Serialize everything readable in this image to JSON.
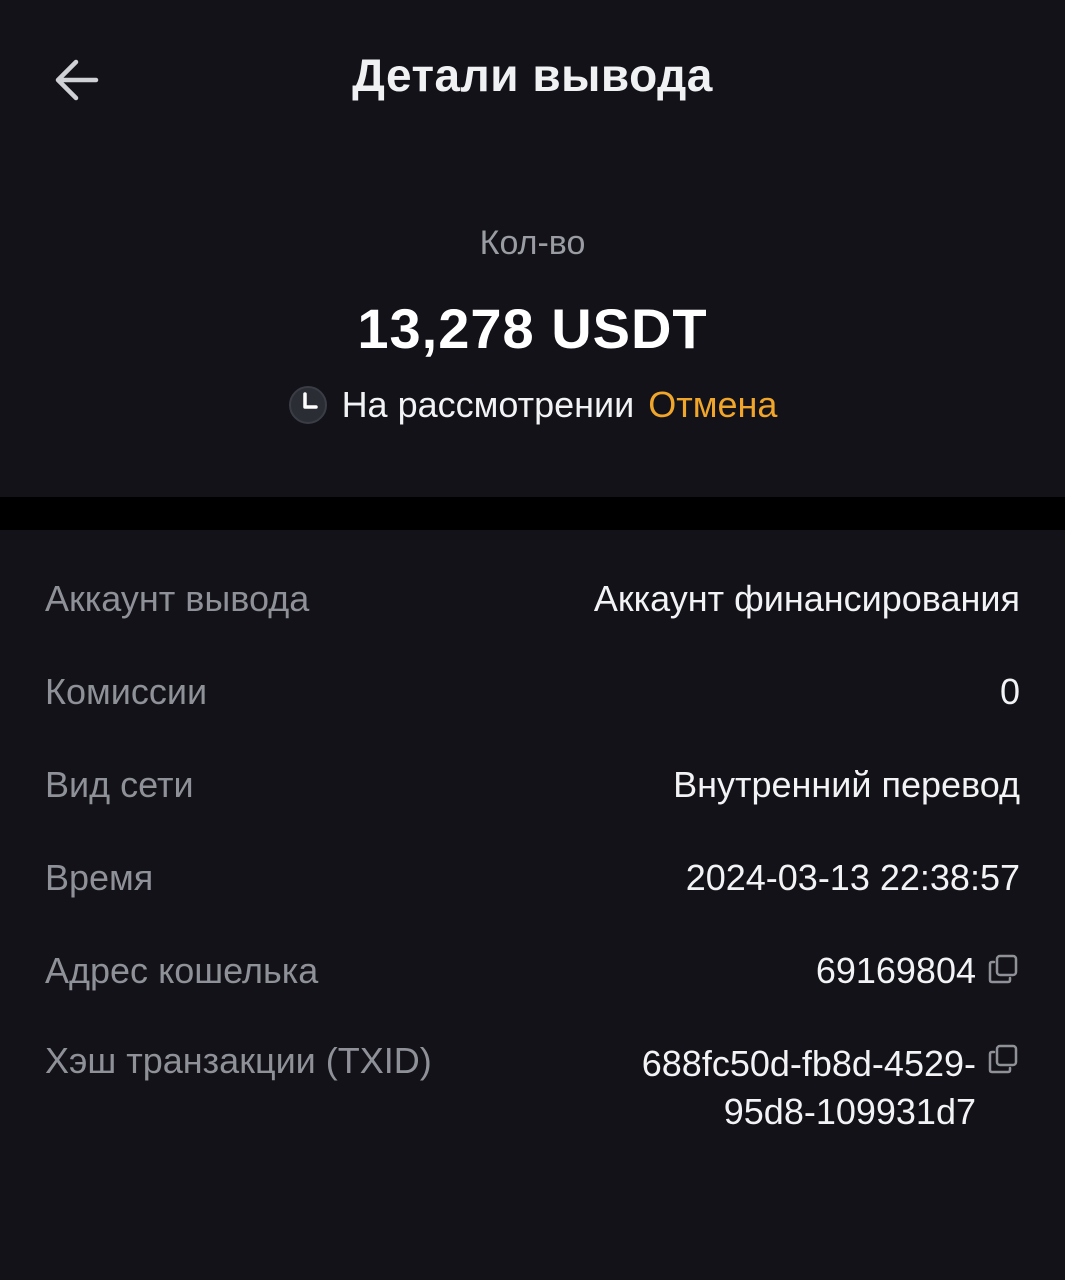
{
  "header": {
    "title": "Детали вывода"
  },
  "summary": {
    "amount_label": "Кол-во",
    "amount_value": "13,278 USDT",
    "status_text": "На рассмотрении",
    "cancel_label": "Отмена"
  },
  "details": {
    "withdraw_account": {
      "label": "Аккаунт вывода",
      "value": "Аккаунт финансирования"
    },
    "fees": {
      "label": "Комиссии",
      "value": "0"
    },
    "network": {
      "label": "Вид сети",
      "value": "Внутренний перевод"
    },
    "time": {
      "label": "Время",
      "value": "2024-03-13 22:38:57"
    },
    "wallet_address": {
      "label": "Адрес кошелька",
      "value": "69169804"
    },
    "txid": {
      "label": "Хэш транзакции (TXID)",
      "value_line1": "688fc50d-fb8d-4529-",
      "value_line2": "95d8-109931d7"
    }
  },
  "colors": {
    "background": "#121218",
    "divider": "#000000",
    "accent": "#f0a52b",
    "label": "#8f9199",
    "text": "#f2f3f5"
  },
  "icons": {
    "back": "arrow-left-icon",
    "status": "clock-icon",
    "copy": "copy-icon"
  }
}
